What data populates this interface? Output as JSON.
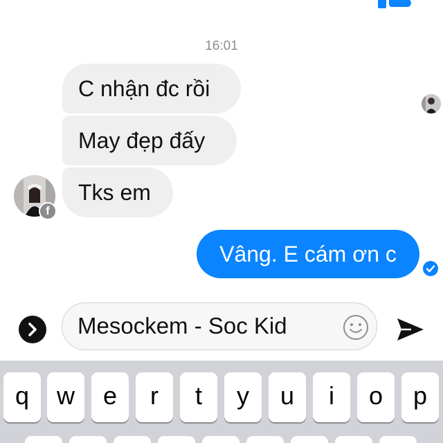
{
  "thread": {
    "timestamp": "16:01",
    "incoming": [
      {
        "text": "C nhận đc rồi"
      },
      {
        "text": "May đẹp đấy"
      },
      {
        "text": "Tks em"
      }
    ],
    "outgoing": [
      {
        "text": "Vâng. E cám ơn c"
      }
    ]
  },
  "composer": {
    "value": "Mesockem - Soc Kid"
  },
  "keyboard": {
    "row1": [
      "q",
      "w",
      "e",
      "r",
      "t",
      "y",
      "u",
      "i",
      "o",
      "p"
    ]
  },
  "colors": {
    "accent": "#0a84ff",
    "incoming_bubble": "#efeff0",
    "keyboard_bg": "#d1d3d9",
    "timestamp": "#8e8e93"
  },
  "icons": {
    "top_reaction": "thumbs-up-icon",
    "contact_badge": "facebook-icon",
    "sent_status": "checkmark-icon",
    "expand": "chevron-right-icon",
    "emoji": "smiley-icon",
    "send": "send-arrow-icon"
  }
}
